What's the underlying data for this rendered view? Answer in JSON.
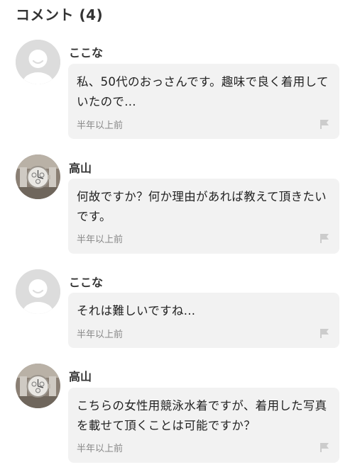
{
  "section": {
    "title": "コメント (4)"
  },
  "comments": [
    {
      "username": "ここな",
      "avatar": "default-avatar-icon",
      "text": "私、50代のおっさんです。趣味で良く着用していたので...",
      "time": "半年以上前"
    },
    {
      "username": "高山",
      "avatar": "wristwatch-avatar",
      "text": "何故ですか？何か理由があれば教えて頂きたいです。",
      "time": "半年以上前"
    },
    {
      "username": "ここな",
      "avatar": "default-avatar-icon",
      "text": "それは難しいですね...",
      "time": "半年以上前"
    },
    {
      "username": "高山",
      "avatar": "wristwatch-avatar",
      "text": "こちらの女性用競泳水着ですが、着用した写真を載せて頂くことは可能ですか？",
      "time": "半年以上前"
    }
  ],
  "icons": {
    "report": "flag-icon"
  },
  "colors": {
    "bubble_background": "#f2f2f2",
    "timestamp": "#888888",
    "flag": "#cccccc",
    "avatar_placeholder": "#dcdcdc"
  }
}
